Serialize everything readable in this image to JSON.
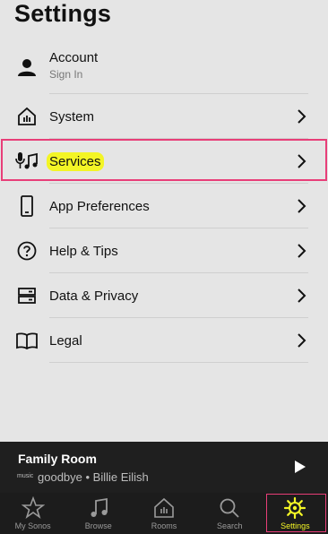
{
  "page": {
    "title": "Settings"
  },
  "settings": {
    "items": [
      {
        "label": "Account",
        "sublabel": "Sign In",
        "icon": "person-icon"
      },
      {
        "label": "System",
        "icon": "house-icon"
      },
      {
        "label": "Services",
        "icon": "mic-music-icon"
      },
      {
        "label": "App Preferences",
        "icon": "phone-icon"
      },
      {
        "label": "Help & Tips",
        "icon": "question-circle-icon"
      },
      {
        "label": "Data & Privacy",
        "icon": "server-icon"
      },
      {
        "label": "Legal",
        "icon": "book-icon"
      }
    ]
  },
  "now_playing": {
    "room": "Family Room",
    "source": "music",
    "track": "goodbye • Billie Eilish"
  },
  "tabs": [
    {
      "label": "My Sonos",
      "icon": "star-icon"
    },
    {
      "label": "Browse",
      "icon": "music-note-icon"
    },
    {
      "label": "Rooms",
      "icon": "house-icon"
    },
    {
      "label": "Search",
      "icon": "search-icon"
    },
    {
      "label": "Settings",
      "icon": "gear-icon",
      "active": true
    }
  ],
  "colors": {
    "highlight": "#f3f526",
    "accent": "#e83e78",
    "bar": "#1f1f1f"
  }
}
